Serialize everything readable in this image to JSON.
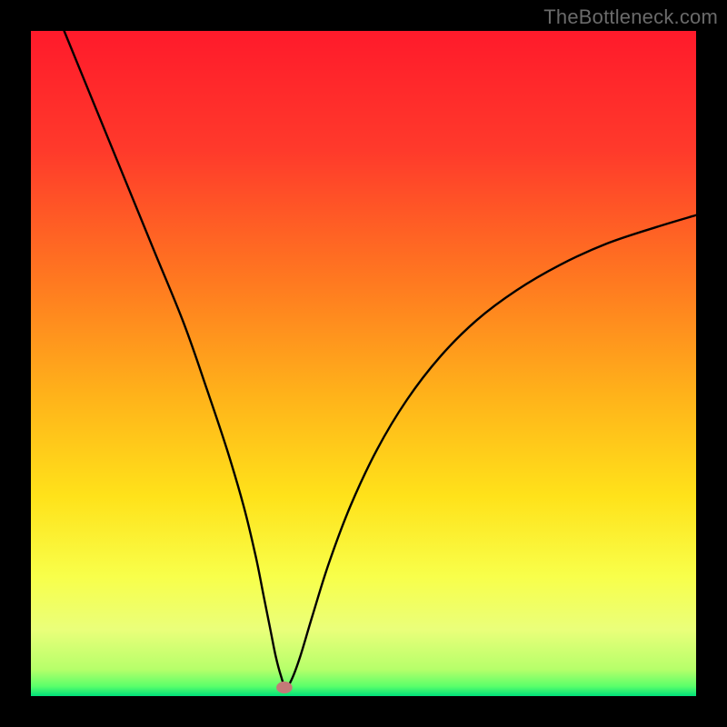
{
  "watermark": "TheBottleneck.com",
  "chart_data": {
    "type": "line",
    "title": "",
    "xlabel": "",
    "ylabel": "",
    "xlim": [
      0,
      100
    ],
    "ylim": [
      0,
      100
    ],
    "grid": false,
    "legend": false,
    "gradient_stops": [
      {
        "offset": 0.0,
        "color": "#ff1a2b"
      },
      {
        "offset": 0.18,
        "color": "#ff3a2b"
      },
      {
        "offset": 0.38,
        "color": "#ff7a20"
      },
      {
        "offset": 0.55,
        "color": "#ffb31a"
      },
      {
        "offset": 0.7,
        "color": "#ffe21a"
      },
      {
        "offset": 0.82,
        "color": "#f8ff4a"
      },
      {
        "offset": 0.9,
        "color": "#eaff7a"
      },
      {
        "offset": 0.96,
        "color": "#b6ff6a"
      },
      {
        "offset": 0.985,
        "color": "#5cff6a"
      },
      {
        "offset": 1.0,
        "color": "#00e07a"
      }
    ],
    "series": [
      {
        "name": "bottleneck-curve",
        "color": "#000000",
        "x": [
          5,
          9.5,
          14,
          18.5,
          23,
          26.5,
          29.5,
          32,
          33.8,
          35,
          36,
          36.8,
          37.6,
          38.3,
          39.2,
          40.5,
          42.3,
          44.8,
          48,
          52,
          56.5,
          61.5,
          67,
          73,
          79.5,
          86.5,
          94,
          100
        ],
        "y": [
          100,
          89,
          78,
          67,
          56,
          46,
          37,
          28.5,
          21,
          15,
          10,
          6,
          3,
          1.3,
          2.5,
          6,
          12,
          20,
          28.5,
          37,
          44.5,
          51,
          56.5,
          61,
          64.8,
          68,
          70.5,
          72.3
        ]
      }
    ],
    "marker": {
      "name": "min-marker",
      "cx": 38.1,
      "cy": 1.3,
      "rx": 1.2,
      "ry": 0.9,
      "fill": "#c47a78"
    }
  }
}
